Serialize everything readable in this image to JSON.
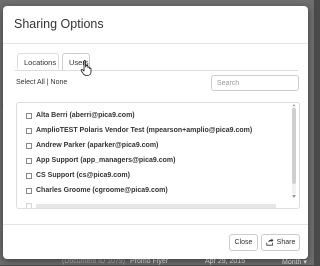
{
  "background": {
    "left_glyph": "e",
    "bottom_doc": "(Document ID 1079)",
    "bottom_item": "Promo Flyer",
    "bottom_date": "Apr 29, 2015",
    "bottom_right": "Month ▾"
  },
  "modal": {
    "title": "Sharing Options",
    "tabs": [
      {
        "label": "Locations",
        "active": false
      },
      {
        "label": "Users",
        "active": true
      }
    ],
    "select": {
      "prefix": "Select",
      "all": "All",
      "separator": "|",
      "none": "None"
    },
    "search": {
      "placeholder": "Search",
      "value": ""
    },
    "users": [
      {
        "label": "Alta Berri (aberri@pica9.com)"
      },
      {
        "label": "AmplioTEST Polaris Vendor Test (mpearson+amplio@pica9.com)"
      },
      {
        "label": "Andrew Parker (aparker@pica9.com)"
      },
      {
        "label": "App Support (app_managers@pica9.com)"
      },
      {
        "label": "CS Support (cs@pica9.com)"
      },
      {
        "label": "Charles Groome (cgroome@pica9.com)"
      }
    ],
    "footer": {
      "close": "Close",
      "share": "Share"
    }
  },
  "icons": {
    "share": "share-icon",
    "cursor": "hand-pointer-icon"
  }
}
